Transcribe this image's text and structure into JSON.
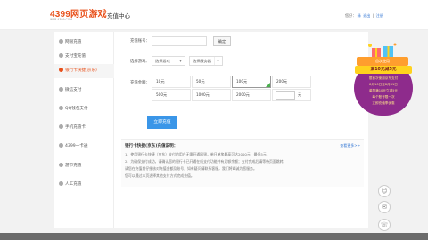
{
  "header": {
    "logo_main": "4399网页游戏",
    "logo_sub": "WEB.4399.COM",
    "title": "充值中心",
    "greeting": "您好：",
    "user": "缘",
    "login": "退出",
    "sep": "|",
    "register": "注册"
  },
  "sidebar": {
    "items": [
      {
        "label": "网银充值",
        "icon": "bank-icon"
      },
      {
        "label": "支付宝充值",
        "icon": "alipay-icon"
      },
      {
        "label": "银行卡快捷(京东)",
        "icon": "card-icon",
        "active": true
      },
      {
        "label": "微信支付",
        "icon": "wechat-icon"
      },
      {
        "label": "QQ钱包支付",
        "icon": "qq-icon"
      },
      {
        "label": "手机充值卡",
        "icon": "phone-icon"
      },
      {
        "label": "4399一卡通",
        "icon": "onecard-icon"
      },
      {
        "label": "游币充值",
        "icon": "coin-icon"
      },
      {
        "label": "人工充值",
        "icon": "person-icon"
      }
    ]
  },
  "form": {
    "account_label": "充值账号：",
    "account_value": "",
    "confirm_label": "确定",
    "game_label": "选择游戏：",
    "game_placeholder": "选择游戏",
    "server_placeholder": "选择服务器",
    "amount_label": "充值金额：",
    "amounts": [
      "10元",
      "50元",
      "100元",
      "200元",
      "500元",
      "1000元",
      "2000元"
    ],
    "selected_amount": "100元",
    "custom_unit": "元",
    "pay_button": "立即充值"
  },
  "notice": {
    "title": "银行卡快捷(京东)充值说明：",
    "more": "查看更多>>",
    "lines": [
      {
        "text": "1、使用银行卡快捷（京东）支付的用户无需开通网银，单日单笔最高可达2000元，最低5元。"
      },
      {
        "text": "2、为确保支付成功，请确认您的银行卡已开通在线支付功能并有足够余额；支付完成后请等待页面跳转。"
      },
      {
        "text": "请您在充值前仔细核对充值金额及账号，如有疑问请联系客服，我们将竭诚为您服务。"
      },
      {
        "text": "您可以通过本页选择其他支付方式完成充值。"
      }
    ]
  },
  "promo": {
    "ribbon": "首次使用",
    "banner": "满10元减5元",
    "lines": [
      "限首次使用京东支付",
      "8月10日至8月31日",
      "单笔满10元立减5元",
      "每个账号限一次",
      "立即充值享优惠"
    ]
  },
  "floating": {
    "service_icon": "customer-service-icon",
    "wechat_icon": "wechat-share-icon",
    "top_icon": "headset-icon"
  },
  "colors": {
    "accent": "#e8501a",
    "primary_button": "#3a96e8",
    "promo_purple": "#8e2b8c",
    "promo_yellow": "#ffd21e"
  }
}
